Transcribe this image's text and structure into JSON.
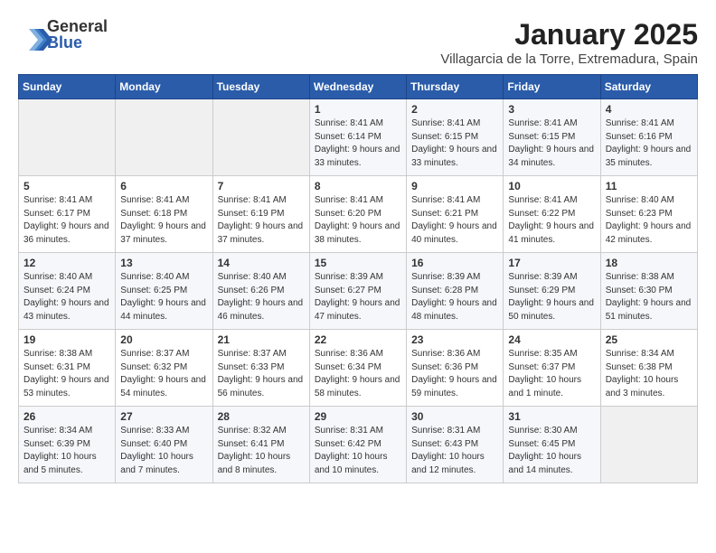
{
  "logo": {
    "text_general": "General",
    "text_blue": "Blue"
  },
  "title": {
    "month_year": "January 2025",
    "location": "Villagarcia de la Torre, Extremadura, Spain"
  },
  "weekdays": [
    "Sunday",
    "Monday",
    "Tuesday",
    "Wednesday",
    "Thursday",
    "Friday",
    "Saturday"
  ],
  "weeks": [
    [
      {
        "day": "",
        "empty": true
      },
      {
        "day": "",
        "empty": true
      },
      {
        "day": "",
        "empty": true
      },
      {
        "day": "1",
        "sunrise": "8:41 AM",
        "sunset": "6:14 PM",
        "daylight": "9 hours and 33 minutes."
      },
      {
        "day": "2",
        "sunrise": "8:41 AM",
        "sunset": "6:15 PM",
        "daylight": "9 hours and 33 minutes."
      },
      {
        "day": "3",
        "sunrise": "8:41 AM",
        "sunset": "6:15 PM",
        "daylight": "9 hours and 34 minutes."
      },
      {
        "day": "4",
        "sunrise": "8:41 AM",
        "sunset": "6:16 PM",
        "daylight": "9 hours and 35 minutes."
      }
    ],
    [
      {
        "day": "5",
        "sunrise": "8:41 AM",
        "sunset": "6:17 PM",
        "daylight": "9 hours and 36 minutes."
      },
      {
        "day": "6",
        "sunrise": "8:41 AM",
        "sunset": "6:18 PM",
        "daylight": "9 hours and 37 minutes."
      },
      {
        "day": "7",
        "sunrise": "8:41 AM",
        "sunset": "6:19 PM",
        "daylight": "9 hours and 37 minutes."
      },
      {
        "day": "8",
        "sunrise": "8:41 AM",
        "sunset": "6:20 PM",
        "daylight": "9 hours and 38 minutes."
      },
      {
        "day": "9",
        "sunrise": "8:41 AM",
        "sunset": "6:21 PM",
        "daylight": "9 hours and 40 minutes."
      },
      {
        "day": "10",
        "sunrise": "8:41 AM",
        "sunset": "6:22 PM",
        "daylight": "9 hours and 41 minutes."
      },
      {
        "day": "11",
        "sunrise": "8:40 AM",
        "sunset": "6:23 PM",
        "daylight": "9 hours and 42 minutes."
      }
    ],
    [
      {
        "day": "12",
        "sunrise": "8:40 AM",
        "sunset": "6:24 PM",
        "daylight": "9 hours and 43 minutes."
      },
      {
        "day": "13",
        "sunrise": "8:40 AM",
        "sunset": "6:25 PM",
        "daylight": "9 hours and 44 minutes."
      },
      {
        "day": "14",
        "sunrise": "8:40 AM",
        "sunset": "6:26 PM",
        "daylight": "9 hours and 46 minutes."
      },
      {
        "day": "15",
        "sunrise": "8:39 AM",
        "sunset": "6:27 PM",
        "daylight": "9 hours and 47 minutes."
      },
      {
        "day": "16",
        "sunrise": "8:39 AM",
        "sunset": "6:28 PM",
        "daylight": "9 hours and 48 minutes."
      },
      {
        "day": "17",
        "sunrise": "8:39 AM",
        "sunset": "6:29 PM",
        "daylight": "9 hours and 50 minutes."
      },
      {
        "day": "18",
        "sunrise": "8:38 AM",
        "sunset": "6:30 PM",
        "daylight": "9 hours and 51 minutes."
      }
    ],
    [
      {
        "day": "19",
        "sunrise": "8:38 AM",
        "sunset": "6:31 PM",
        "daylight": "9 hours and 53 minutes."
      },
      {
        "day": "20",
        "sunrise": "8:37 AM",
        "sunset": "6:32 PM",
        "daylight": "9 hours and 54 minutes."
      },
      {
        "day": "21",
        "sunrise": "8:37 AM",
        "sunset": "6:33 PM",
        "daylight": "9 hours and 56 minutes."
      },
      {
        "day": "22",
        "sunrise": "8:36 AM",
        "sunset": "6:34 PM",
        "daylight": "9 hours and 58 minutes."
      },
      {
        "day": "23",
        "sunrise": "8:36 AM",
        "sunset": "6:36 PM",
        "daylight": "9 hours and 59 minutes."
      },
      {
        "day": "24",
        "sunrise": "8:35 AM",
        "sunset": "6:37 PM",
        "daylight": "10 hours and 1 minute."
      },
      {
        "day": "25",
        "sunrise": "8:34 AM",
        "sunset": "6:38 PM",
        "daylight": "10 hours and 3 minutes."
      }
    ],
    [
      {
        "day": "26",
        "sunrise": "8:34 AM",
        "sunset": "6:39 PM",
        "daylight": "10 hours and 5 minutes."
      },
      {
        "day": "27",
        "sunrise": "8:33 AM",
        "sunset": "6:40 PM",
        "daylight": "10 hours and 7 minutes."
      },
      {
        "day": "28",
        "sunrise": "8:32 AM",
        "sunset": "6:41 PM",
        "daylight": "10 hours and 8 minutes."
      },
      {
        "day": "29",
        "sunrise": "8:31 AM",
        "sunset": "6:42 PM",
        "daylight": "10 hours and 10 minutes."
      },
      {
        "day": "30",
        "sunrise": "8:31 AM",
        "sunset": "6:43 PM",
        "daylight": "10 hours and 12 minutes."
      },
      {
        "day": "31",
        "sunrise": "8:30 AM",
        "sunset": "6:45 PM",
        "daylight": "10 hours and 14 minutes."
      },
      {
        "day": "",
        "empty": true
      }
    ]
  ]
}
